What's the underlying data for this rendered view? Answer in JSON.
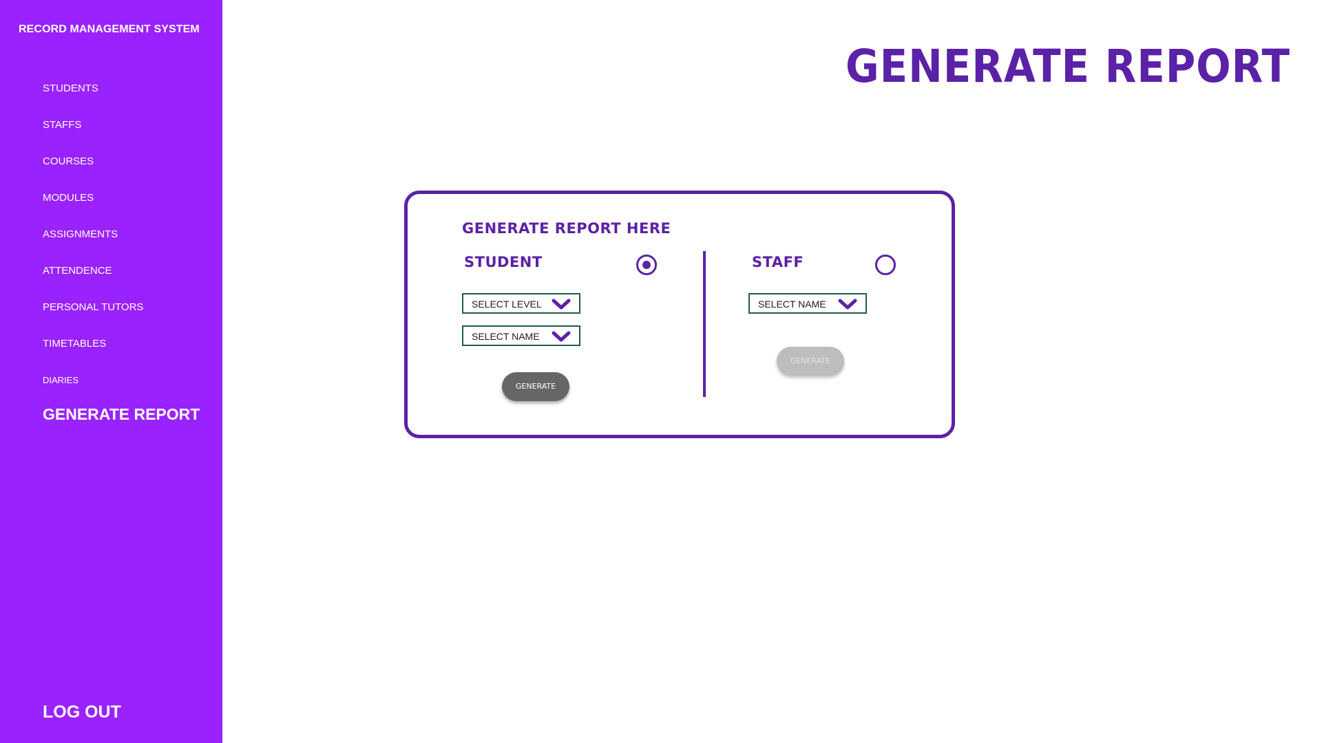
{
  "sidebar": {
    "app_title": "RECORD MANAGEMENT SYSTEM",
    "items": [
      {
        "label": "STUDENTS"
      },
      {
        "label": "STAFFS"
      },
      {
        "label": "COURSES"
      },
      {
        "label": "MODULES"
      },
      {
        "label": "ASSIGNMENTS"
      },
      {
        "label": "ATTENDENCE"
      },
      {
        "label": "PERSONAL TUTORS"
      },
      {
        "label": "TIMETABLES"
      },
      {
        "label": "DIARIES"
      },
      {
        "label": "GENERATE REPORT"
      }
    ],
    "logout_label": "LOG OUT",
    "background_color": "#9a22ff"
  },
  "main": {
    "page_title": "GENERATE REPORT",
    "card": {
      "heading": "GENERATE REPORT HERE",
      "student": {
        "label": "STUDENT",
        "radio_selected": true,
        "select_level_label": "SELECT LEVEL",
        "select_name_label": "SELECT NAME",
        "generate_label": "GENERATE",
        "generate_enabled": true
      },
      "staff": {
        "label": "STAFF",
        "radio_selected": false,
        "select_name_label": "SELECT NAME",
        "generate_label": "GENERATE",
        "generate_enabled": false
      }
    },
    "accent_color": "#5b21a6",
    "select_border_color": "#1f5c45"
  },
  "icons": {
    "dropdown": "chevron-down-icon",
    "radio": "radio-icon"
  }
}
